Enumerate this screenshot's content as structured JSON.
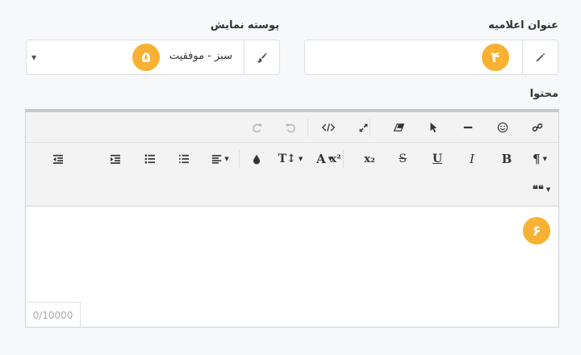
{
  "fields": {
    "title": {
      "label": "عنوان اعلامیه",
      "value": "",
      "badge": "۴",
      "icon": "pencil-icon"
    },
    "skin": {
      "label": "پوسته نمایش",
      "value": "سبز - موفقیت",
      "badge": "۵",
      "icon": "paintbrush-icon"
    },
    "content": {
      "label": "محتوا",
      "badge": "۶",
      "counter": "0/10000"
    }
  },
  "toolbar": {
    "row1": [
      "link-icon",
      "emoji-icon",
      "horizontal-rule-icon",
      "select-cursor-icon",
      "eraser-icon",
      "fullscreen-icon",
      "code-view-icon",
      "undo-icon",
      "redo-icon"
    ],
    "row2": {
      "paragraph": "¶",
      "bold": "B",
      "italic": "I",
      "underline": "U",
      "strikethrough": "S",
      "subscript": "x₂",
      "superscript": "x²",
      "font_color": "A",
      "font_size": "T↕",
      "highlight": "drop-icon",
      "align": "align-icon",
      "ordered_list": "ordered-list-icon",
      "unordered_list": "unordered-list-icon",
      "indent": "indent-icon",
      "outdent": "outdent-icon"
    },
    "row3": {
      "quote": "❝❝"
    }
  },
  "colors": {
    "badge": "#f8b133",
    "toolbar_bg": "#f3f3f3",
    "page_bg": "#f7f8fa"
  }
}
